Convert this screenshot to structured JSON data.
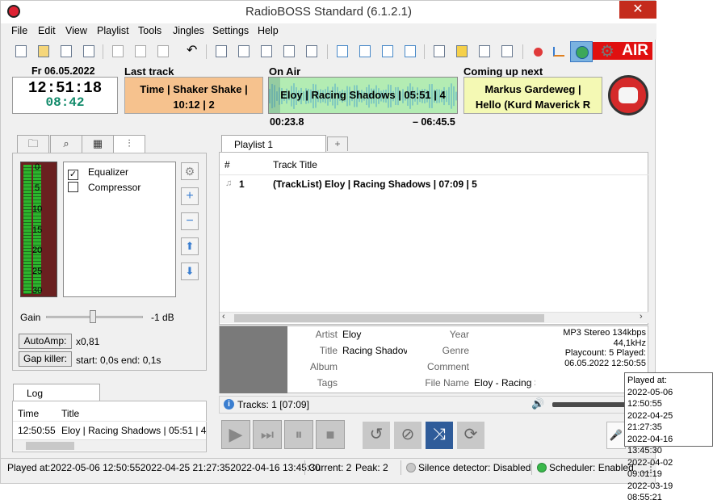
{
  "window": {
    "title": "RadioBOSS Standard (6.1.2.1)",
    "close_glyph": "✕"
  },
  "menu": [
    "File",
    "Edit",
    "View",
    "Playlist",
    "Tools",
    "Jingles",
    "Settings",
    "Help"
  ],
  "onair_badge": "AIR",
  "clock": {
    "date": "Fr 06.05.2022",
    "time": "12:51:18",
    "remaining": "08:42"
  },
  "last_track": {
    "label": "Last track",
    "line1": "Time | Shaker Shake |",
    "line2": "10:12 | 2"
  },
  "on_air": {
    "label": "On Air",
    "text": "Eloy | Racing Shadows | 05:51 | 4",
    "elapsed": "00:23.8",
    "remaining": "– 06:45.5",
    "progress": 0.06
  },
  "coming_up": {
    "label": "Coming up next",
    "line1": "Markus Gardeweg |",
    "line2": "Hello  (Kurd  Maverick R"
  },
  "effects": {
    "vu_scale": [
      "0",
      "5",
      "10",
      "15",
      "20",
      "25",
      "30"
    ],
    "items": [
      {
        "label": "Equalizer",
        "checked": true,
        "mark": "✓"
      },
      {
        "label": "Compressor",
        "checked": false,
        "mark": ""
      }
    ],
    "gain_label": "Gain",
    "gain_value": "-1 dB",
    "autoamp_label": "AutoAmp:",
    "autoamp_value": "x0,81",
    "gapkiller_label": "Gap killer:",
    "gapkiller_value": "start: 0,0s end: 0,1s"
  },
  "log": {
    "tab": "Log",
    "col_time": "Time",
    "col_title": "Title",
    "rows": [
      {
        "time": "12:50:55",
        "title": "Eloy | Racing Shadows | 05:51 | 4"
      }
    ]
  },
  "playlist": {
    "tab": "Playlist 1",
    "add_tab_glyph": "+",
    "col_num": "#",
    "col_title": "Track Title",
    "rows": [
      {
        "num": "1",
        "title": "(TrackList) Eloy | Racing Shadows | 07:09 | 5"
      }
    ],
    "tracks_info": "Tracks: 1 [07:09]"
  },
  "track_info": {
    "artist_label": "Artist",
    "artist": "Eloy",
    "title_label": "Title",
    "title": "Racing Shadov",
    "album_label": "Album",
    "album": "",
    "tags_label": "Tags",
    "tags": "",
    "year_label": "Year",
    "year": "",
    "genre_label": "Genre",
    "genre": "",
    "comment_label": "Comment",
    "comment": "",
    "filename_label": "File Name",
    "filename": "Eloy - Racing S",
    "format": "MP3 Stereo 134kbps",
    "samplerate": "44,1kHz",
    "playcount": "Playcount: 5  Played:",
    "played": "06.05.2022 12:50:55"
  },
  "player": {
    "play": "▶",
    "next": "⏭",
    "pause": "⏸",
    "stop": "■",
    "repeat": "↺",
    "block": "⊘",
    "shuffle": "⤨",
    "loop": "⟳",
    "mic": "🎤",
    "volume": "🔊"
  },
  "status": {
    "played_at": "Played at:2022-05-06 12:50:552022-04-25 21:27:352022-04-16 13:45:30",
    "current": "Current: 2",
    "peak": "Peak: 2",
    "silence": "Silence detector: Disabled",
    "scheduler": "Scheduler: Enabled"
  },
  "tooltip": {
    "title": "Played at:",
    "entries": [
      "2022-05-06 12:50:55",
      "2022-04-25 21:27:35",
      "2022-04-16 13:45:30",
      "2022-04-02 09:01:19",
      "2022-03-19 08:55:21"
    ]
  }
}
